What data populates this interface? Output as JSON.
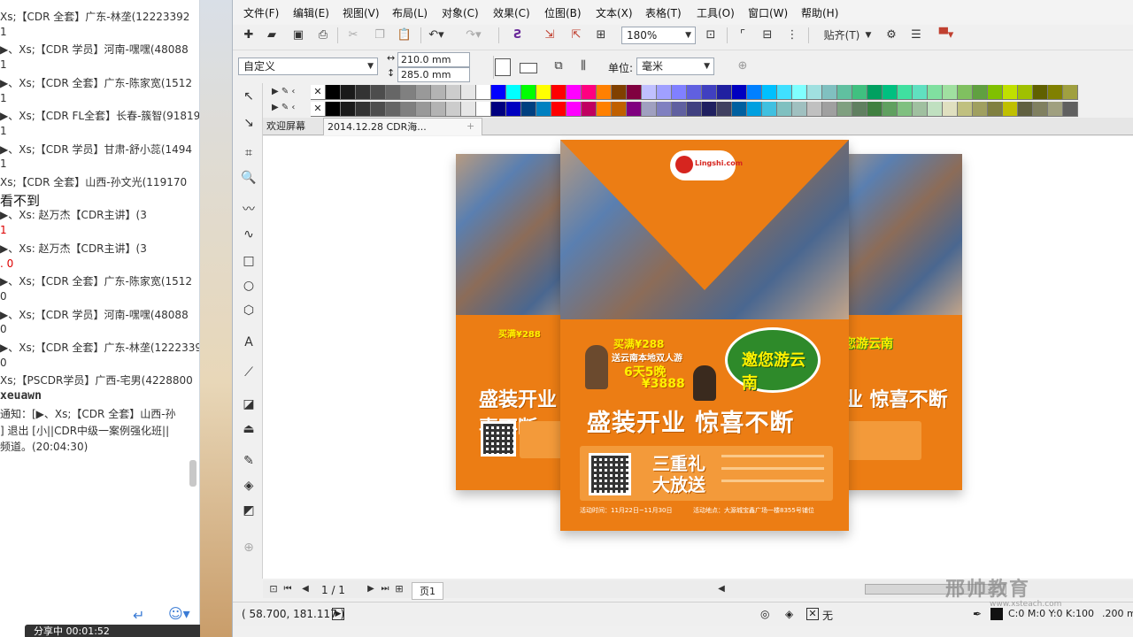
{
  "chat": {
    "lines": [
      {
        "text": "Xs;【CDR 全套】广东-林垄(12223392",
        "style": ""
      },
      {
        "text": "1",
        "style": ""
      },
      {
        "text": "▶、Xs;【CDR 学员】河南-嘿嘿(48088",
        "style": ""
      },
      {
        "text": "1",
        "style": ""
      },
      {
        "text": "▶、Xs;【CDR 全套】广东-陈家宽(1512",
        "style": ""
      },
      {
        "text": "1",
        "style": ""
      },
      {
        "text": "▶、Xs;【CDR FL全套】长春-簇智(918193",
        "style": ""
      },
      {
        "text": "1",
        "style": ""
      },
      {
        "text": "▶、Xs;【CDR 学员】甘肃-舒小蕊(1494",
        "style": ""
      },
      {
        "text": "1",
        "style": ""
      },
      {
        "text": "Xs;【CDR 全套】山西-孙文光(119170",
        "style": ""
      },
      {
        "text": "看不到",
        "style": "big"
      },
      {
        "text": "    ▶、Xs:  赵万杰【CDR主讲】(3",
        "style": ""
      },
      {
        "text": "1",
        "style": "red"
      },
      {
        "text": "    ▶、Xs:  赵万杰【CDR主讲】(3",
        "style": ""
      },
      {
        "text": ". 0",
        "style": "red"
      },
      {
        "text": "▶、Xs;【CDR 全套】广东-陈家宽(1512",
        "style": ""
      },
      {
        "text": "0",
        "style": ""
      },
      {
        "text": "▶、Xs;【CDR 学员】河南-嘿嘿(48088",
        "style": ""
      },
      {
        "text": "0",
        "style": ""
      },
      {
        "text": "▶、Xs;【CDR 全套】广东-林垄(12223392",
        "style": ""
      },
      {
        "text": "0",
        "style": ""
      },
      {
        "text": "Xs;【PSCDR学员】广西-宅男(4228800",
        "style": ""
      },
      {
        "text": "xeuawn",
        "style": "bold"
      },
      {
        "text": "通知：[▶、Xs;【CDR 全套】山西-孙",
        "style": ""
      },
      {
        "text": "] 退出 [小||CDR中级一案例强化班||",
        "style": ""
      },
      {
        "text": "频道。(20:04:30)",
        "style": ""
      }
    ],
    "share_status": "分享中 00:01:52"
  },
  "menu": [
    "文件(F)",
    "编辑(E)",
    "视图(V)",
    "布局(L)",
    "对象(C)",
    "效果(C)",
    "位图(B)",
    "文本(X)",
    "表格(T)",
    "工具(O)",
    "窗口(W)",
    "帮助(H)"
  ],
  "toolbar": {
    "zoom": "180%",
    "snap_label": "贴齐(T)"
  },
  "propbar": {
    "preset": "自定义",
    "width": "210.0 mm",
    "height": "285.0 mm",
    "unit_label": "单位:",
    "unit_value": "毫米"
  },
  "tabs": {
    "welcome": "欢迎屏幕",
    "doc": "2014.12.28 CDR海..."
  },
  "palette_row1": [
    "#ffffff",
    "#000000",
    "#1a1a1a",
    "#333333",
    "#4d4d4d",
    "#666666",
    "#808080",
    "#999999",
    "#b3b3b3",
    "#cccccc",
    "#e6e6e6",
    "#ffffff",
    "#0000ff",
    "#00ffff",
    "#00ff00",
    "#ffff00",
    "#ff0000",
    "#ff00ff",
    "#ff0080",
    "#ff8000",
    "#804000",
    "#800040",
    "#c0c0ff",
    "#a0a0ff",
    "#8080ff",
    "#6060e0",
    "#4040c0",
    "#2020a0",
    "#0000c0",
    "#0080ff",
    "#00c0ff",
    "#40e0ff",
    "#80ffff",
    "#a0e0e0",
    "#80c0c0",
    "#60c0a0",
    "#40c080",
    "#00a060",
    "#00c080",
    "#40e0a0",
    "#60e0c0",
    "#80e0a0",
    "#a0e0a0",
    "#80c060",
    "#60a040",
    "#80c000",
    "#c0e000",
    "#a0c000",
    "#606000",
    "#808000",
    "#a0a040"
  ],
  "palette_row2": [
    "#ffffff",
    "#000000",
    "#1a1a1a",
    "#333333",
    "#4d4d4d",
    "#666666",
    "#808080",
    "#999999",
    "#b3b3b3",
    "#cccccc",
    "#e6e6e6",
    "#ffffff",
    "#000080",
    "#0000c0",
    "#004080",
    "#0080c0",
    "#ff0000",
    "#ff00ff",
    "#c00060",
    "#ff8000",
    "#c06000",
    "#800080",
    "#a0a0c0",
    "#8080c0",
    "#6060a0",
    "#404080",
    "#202060",
    "#404060",
    "#0060a0",
    "#00a0e0",
    "#40c0e0",
    "#80c0c0",
    "#a0c0c0",
    "#c0c0c0",
    "#a0a0a0",
    "#80a080",
    "#608060",
    "#408040",
    "#60a060",
    "#80c080",
    "#a0c0a0",
    "#c0e0c0",
    "#e0e0c0",
    "#c0c080",
    "#a0a060",
    "#808040",
    "#c0c000",
    "#606040",
    "#808060",
    "#a0a080",
    "#606060"
  ],
  "flyer": {
    "buy_line": "买满¥288",
    "gift_line": "送云南本地双人游",
    "days": "6天5晚",
    "price": "¥3888",
    "headline": "盛装开业 惊喜不断",
    "promo_title": "三重礼 大放送",
    "tagline": "邀您游云南",
    "logo": "Lingshi.com",
    "footer_time": "活动时间：11月22日~11月30日",
    "footer_place": "活动地点：大源城宝鑫广场一楼8355号铺位"
  },
  "pagenav": {
    "counter": "1 / 1",
    "page_tab": "页1"
  },
  "status": {
    "coords": "( 58.700, 181.117 )",
    "fill_none": "无",
    "color": "C:0 M:0 Y:0 K:100",
    "outline": ".200 m"
  },
  "watermark": {
    "brand": "邢帅教育",
    "url": "www.xsteach.com"
  },
  "colors": {
    "flyer_orange": "#ec7d14",
    "chat_bg": "#ffffff",
    "app_bg": "#f0f0f0"
  }
}
